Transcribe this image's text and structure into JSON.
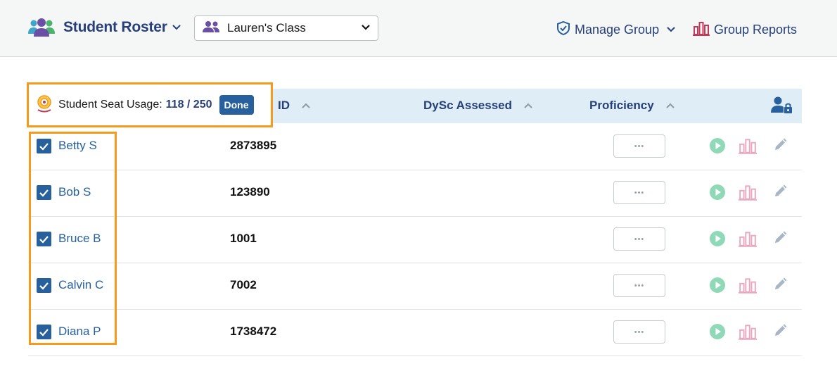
{
  "header": {
    "app_title": "Student Roster",
    "class_select": {
      "value": "Lauren's Class"
    },
    "manage_group": "Manage Group",
    "group_reports": "Group Reports"
  },
  "seat_usage": {
    "label": "Student Seat Usage:",
    "count": "118 / 250",
    "done_label": "Done"
  },
  "table": {
    "columns": {
      "id": "ID",
      "dysc": "DySc Assessed",
      "proficiency": "Proficiency"
    },
    "more_label": "•••",
    "rows": [
      {
        "name": "Betty S",
        "id": "2873895",
        "checked": true
      },
      {
        "name": "Bob S",
        "id": "123890",
        "checked": true
      },
      {
        "name": "Bruce B",
        "id": "1001",
        "checked": true
      },
      {
        "name": "Calvin C",
        "id": "7002",
        "checked": true
      },
      {
        "name": "Diana P",
        "id": "1738472",
        "checked": true
      }
    ]
  },
  "colors": {
    "primary": "#27407a",
    "link": "#27609c",
    "header_bg": "#dfeef6",
    "highlight": "#f39a1f",
    "play": "#8fd9b8",
    "reports_pink": "#e8a9c0"
  },
  "icons": [
    "users-icon",
    "chevron-down-icon",
    "group-icon",
    "shield-check-icon",
    "bar-chart-icon",
    "seat-target-icon",
    "sort-up-icon",
    "user-lock-icon",
    "check-icon",
    "play-icon",
    "pencil-icon"
  ]
}
